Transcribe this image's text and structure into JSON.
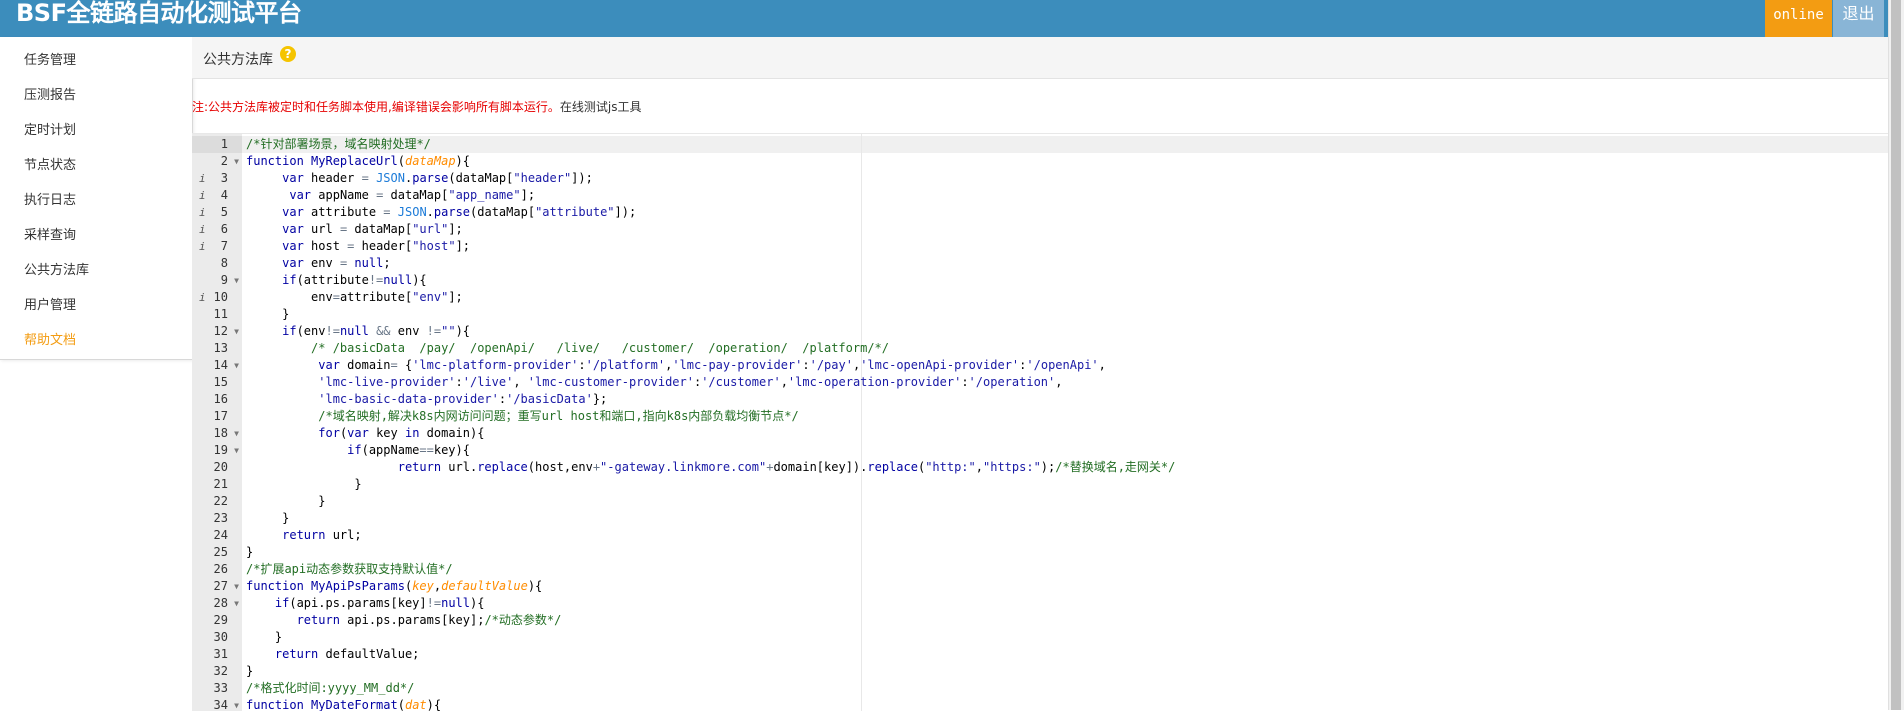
{
  "header": {
    "logo": "BSF全链路自动化测试平台",
    "online_label": "online",
    "logout_label": "退出"
  },
  "sidebar": {
    "items": [
      {
        "label": "任务管理",
        "active": false
      },
      {
        "label": "压测报告",
        "active": false
      },
      {
        "label": "定时计划",
        "active": false
      },
      {
        "label": "节点状态",
        "active": false
      },
      {
        "label": "执行日志",
        "active": false
      },
      {
        "label": "采样查询",
        "active": false
      },
      {
        "label": "公共方法库",
        "active": false
      },
      {
        "label": "用户管理",
        "active": false
      },
      {
        "label": "帮助文档",
        "active": true
      }
    ]
  },
  "page": {
    "title": "公共方法库",
    "help_icon": "question-circle-icon",
    "notice": "注:公共方法库被定时和任务脚本使用,编译错误会影响所有脚本运行。",
    "notice_link": "在线测试js工具"
  },
  "editor": {
    "lines": [
      {
        "n": "1",
        "info": false,
        "fold": false,
        "tokens": [
          [
            "cm",
            "/*针对部署场景，域名映射处理*/"
          ]
        ]
      },
      {
        "n": "2",
        "info": false,
        "fold": true,
        "tokens": [
          [
            "kw",
            "function "
          ],
          [
            "fn",
            "MyReplaceUrl"
          ],
          [
            "tx",
            "("
          ],
          [
            "pa",
            "dataMap"
          ],
          [
            "tx",
            "){"
          ]
        ]
      },
      {
        "n": "3",
        "info": true,
        "fold": false,
        "tokens": [
          [
            "tx",
            "     "
          ],
          [
            "kw",
            "var"
          ],
          [
            "tx",
            " header "
          ],
          [
            "op",
            "="
          ],
          [
            "tx",
            " "
          ],
          [
            "bi",
            "JSON"
          ],
          [
            "tx",
            "."
          ],
          [
            "fn",
            "parse"
          ],
          [
            "tx",
            "(dataMap["
          ],
          [
            "st",
            "\"header\""
          ],
          [
            "tx",
            "]);"
          ]
        ]
      },
      {
        "n": "4",
        "info": true,
        "fold": false,
        "tokens": [
          [
            "tx",
            "      "
          ],
          [
            "kw",
            "var"
          ],
          [
            "tx",
            " appName "
          ],
          [
            "op",
            "="
          ],
          [
            "tx",
            " dataMap["
          ],
          [
            "st",
            "\"app_name\""
          ],
          [
            "tx",
            "];"
          ]
        ]
      },
      {
        "n": "5",
        "info": true,
        "fold": false,
        "tokens": [
          [
            "tx",
            "     "
          ],
          [
            "kw",
            "var"
          ],
          [
            "tx",
            " attribute "
          ],
          [
            "op",
            "="
          ],
          [
            "tx",
            " "
          ],
          [
            "bi",
            "JSON"
          ],
          [
            "tx",
            "."
          ],
          [
            "fn",
            "parse"
          ],
          [
            "tx",
            "(dataMap["
          ],
          [
            "st",
            "\"attribute\""
          ],
          [
            "tx",
            "]);"
          ]
        ]
      },
      {
        "n": "6",
        "info": true,
        "fold": false,
        "tokens": [
          [
            "tx",
            "     "
          ],
          [
            "kw",
            "var"
          ],
          [
            "tx",
            " url "
          ],
          [
            "op",
            "="
          ],
          [
            "tx",
            " dataMap["
          ],
          [
            "st",
            "\"url\""
          ],
          [
            "tx",
            "];"
          ]
        ]
      },
      {
        "n": "7",
        "info": true,
        "fold": false,
        "tokens": [
          [
            "tx",
            "     "
          ],
          [
            "kw",
            "var"
          ],
          [
            "tx",
            " host "
          ],
          [
            "op",
            "="
          ],
          [
            "tx",
            " header["
          ],
          [
            "st",
            "\"host\""
          ],
          [
            "tx",
            "];"
          ]
        ]
      },
      {
        "n": "8",
        "info": false,
        "fold": false,
        "tokens": [
          [
            "tx",
            "     "
          ],
          [
            "kw",
            "var"
          ],
          [
            "tx",
            " env "
          ],
          [
            "op",
            "="
          ],
          [
            "tx",
            " "
          ],
          [
            "kw",
            "null"
          ],
          [
            "tx",
            ";"
          ]
        ]
      },
      {
        "n": "9",
        "info": false,
        "fold": true,
        "tokens": [
          [
            "tx",
            "     "
          ],
          [
            "kw",
            "if"
          ],
          [
            "tx",
            "(attribute"
          ],
          [
            "op",
            "!="
          ],
          [
            "kw",
            "null"
          ],
          [
            "tx",
            "){"
          ]
        ]
      },
      {
        "n": "10",
        "info": true,
        "fold": false,
        "tokens": [
          [
            "tx",
            "         env"
          ],
          [
            "op",
            "="
          ],
          [
            "tx",
            "attribute["
          ],
          [
            "st",
            "\"env\""
          ],
          [
            "tx",
            "];"
          ]
        ]
      },
      {
        "n": "11",
        "info": false,
        "fold": false,
        "tokens": [
          [
            "tx",
            "     }"
          ]
        ]
      },
      {
        "n": "12",
        "info": false,
        "fold": true,
        "tokens": [
          [
            "tx",
            "     "
          ],
          [
            "kw",
            "if"
          ],
          [
            "tx",
            "(env"
          ],
          [
            "op",
            "!="
          ],
          [
            "kw",
            "null"
          ],
          [
            "tx",
            " "
          ],
          [
            "op",
            "&&"
          ],
          [
            "tx",
            " env "
          ],
          [
            "op",
            "!="
          ],
          [
            "st",
            "\"\""
          ],
          [
            "tx",
            "){"
          ]
        ]
      },
      {
        "n": "13",
        "info": false,
        "fold": false,
        "tokens": [
          [
            "tx",
            "         "
          ],
          [
            "cm",
            "/* /basicData  /pay/  /openApi/   /live/   /customer/  /operation/  /platform/*/"
          ]
        ]
      },
      {
        "n": "14",
        "info": false,
        "fold": true,
        "tokens": [
          [
            "tx",
            "          "
          ],
          [
            "kw",
            "var"
          ],
          [
            "tx",
            " domain"
          ],
          [
            "op",
            "="
          ],
          [
            "tx",
            " {"
          ],
          [
            "st",
            "'lmc-platform-provider'"
          ],
          [
            "tx",
            ":"
          ],
          [
            "st",
            "'/platform'"
          ],
          [
            "tx",
            ","
          ],
          [
            "st",
            "'lmc-pay-provider'"
          ],
          [
            "tx",
            ":"
          ],
          [
            "st",
            "'/pay'"
          ],
          [
            "tx",
            ","
          ],
          [
            "st",
            "'lmc-openApi-provider'"
          ],
          [
            "tx",
            ":"
          ],
          [
            "st",
            "'/openApi'"
          ],
          [
            "tx",
            ","
          ]
        ]
      },
      {
        "n": "15",
        "info": false,
        "fold": false,
        "tokens": [
          [
            "tx",
            "          "
          ],
          [
            "st",
            "'lmc-live-provider'"
          ],
          [
            "tx",
            ":"
          ],
          [
            "st",
            "'/live'"
          ],
          [
            "tx",
            ", "
          ],
          [
            "st",
            "'lmc-customer-provider'"
          ],
          [
            "tx",
            ":"
          ],
          [
            "st",
            "'/customer'"
          ],
          [
            "tx",
            ","
          ],
          [
            "st",
            "'lmc-operation-provider'"
          ],
          [
            "tx",
            ":"
          ],
          [
            "st",
            "'/operation'"
          ],
          [
            "tx",
            ","
          ]
        ]
      },
      {
        "n": "16",
        "info": false,
        "fold": false,
        "tokens": [
          [
            "tx",
            "          "
          ],
          [
            "st",
            "'lmc-basic-data-provider'"
          ],
          [
            "tx",
            ":"
          ],
          [
            "st",
            "'/basicData'"
          ],
          [
            "tx",
            "};"
          ]
        ]
      },
      {
        "n": "17",
        "info": false,
        "fold": false,
        "tokens": [
          [
            "tx",
            "          "
          ],
          [
            "cm",
            "/*域名映射,解决k8s内网访问问题；重写url host和端口,指向k8s内部负载均衡节点*/"
          ]
        ]
      },
      {
        "n": "18",
        "info": false,
        "fold": true,
        "tokens": [
          [
            "tx",
            "          "
          ],
          [
            "kw",
            "for"
          ],
          [
            "tx",
            "("
          ],
          [
            "kw",
            "var"
          ],
          [
            "tx",
            " key "
          ],
          [
            "kw",
            "in"
          ],
          [
            "tx",
            " domain){"
          ]
        ]
      },
      {
        "n": "19",
        "info": false,
        "fold": true,
        "tokens": [
          [
            "tx",
            "              "
          ],
          [
            "kw",
            "if"
          ],
          [
            "tx",
            "(appName"
          ],
          [
            "op",
            "=="
          ],
          [
            "tx",
            "key){"
          ]
        ]
      },
      {
        "n": "20",
        "info": false,
        "fold": false,
        "tokens": [
          [
            "tx",
            "                     "
          ],
          [
            "kw",
            "return"
          ],
          [
            "tx",
            " url."
          ],
          [
            "fn",
            "replace"
          ],
          [
            "tx",
            "(host,env"
          ],
          [
            "op",
            "+"
          ],
          [
            "st",
            "\"-gateway.linkmore.com\""
          ],
          [
            "op",
            "+"
          ],
          [
            "tx",
            "domain[key])."
          ],
          [
            "fn",
            "replace"
          ],
          [
            "tx",
            "("
          ],
          [
            "st",
            "\"http:\""
          ],
          [
            "tx",
            ","
          ],
          [
            "st",
            "\"https:\""
          ],
          [
            "tx",
            ");"
          ],
          [
            "cm",
            "/*替换域名,走网关*/"
          ]
        ]
      },
      {
        "n": "21",
        "info": false,
        "fold": false,
        "tokens": [
          [
            "tx",
            "               }"
          ]
        ]
      },
      {
        "n": "22",
        "info": false,
        "fold": false,
        "tokens": [
          [
            "tx",
            "          }"
          ]
        ]
      },
      {
        "n": "23",
        "info": false,
        "fold": false,
        "tokens": [
          [
            "tx",
            "     }"
          ]
        ]
      },
      {
        "n": "24",
        "info": false,
        "fold": false,
        "tokens": [
          [
            "tx",
            "     "
          ],
          [
            "kw",
            "return"
          ],
          [
            "tx",
            " url;"
          ]
        ]
      },
      {
        "n": "25",
        "info": false,
        "fold": false,
        "tokens": [
          [
            "tx",
            "}"
          ]
        ]
      },
      {
        "n": "26",
        "info": false,
        "fold": false,
        "tokens": [
          [
            "cm",
            "/*扩展api动态参数获取支持默认值*/"
          ]
        ]
      },
      {
        "n": "27",
        "info": false,
        "fold": true,
        "tokens": [
          [
            "kw",
            "function "
          ],
          [
            "fn",
            "MyApiPsParams"
          ],
          [
            "tx",
            "("
          ],
          [
            "pa",
            "key"
          ],
          [
            "tx",
            ","
          ],
          [
            "pa",
            "defaultValue"
          ],
          [
            "tx",
            "){"
          ]
        ]
      },
      {
        "n": "28",
        "info": false,
        "fold": true,
        "tokens": [
          [
            "tx",
            "    "
          ],
          [
            "kw",
            "if"
          ],
          [
            "tx",
            "(api.ps.params[key]"
          ],
          [
            "op",
            "!="
          ],
          [
            "kw",
            "null"
          ],
          [
            "tx",
            "){"
          ]
        ]
      },
      {
        "n": "29",
        "info": false,
        "fold": false,
        "tokens": [
          [
            "tx",
            "       "
          ],
          [
            "kw",
            "return"
          ],
          [
            "tx",
            " api.ps.params[key];"
          ],
          [
            "cm",
            "/*动态参数*/"
          ]
        ]
      },
      {
        "n": "30",
        "info": false,
        "fold": false,
        "tokens": [
          [
            "tx",
            "    }"
          ]
        ]
      },
      {
        "n": "31",
        "info": false,
        "fold": false,
        "tokens": [
          [
            "tx",
            "    "
          ],
          [
            "kw",
            "return"
          ],
          [
            "tx",
            " defaultValue;"
          ]
        ]
      },
      {
        "n": "32",
        "info": false,
        "fold": false,
        "tokens": [
          [
            "tx",
            "}"
          ]
        ]
      },
      {
        "n": "33",
        "info": false,
        "fold": false,
        "tokens": [
          [
            "cm",
            "/*格式化时间:yyyy_MM_dd*/"
          ]
        ]
      },
      {
        "n": "34",
        "info": false,
        "fold": true,
        "tokens": [
          [
            "kw",
            "function "
          ],
          [
            "fn",
            "MyDateFormat"
          ],
          [
            "tx",
            "("
          ],
          [
            "pa",
            "dat"
          ],
          [
            "tx",
            "){"
          ]
        ]
      }
    ]
  }
}
